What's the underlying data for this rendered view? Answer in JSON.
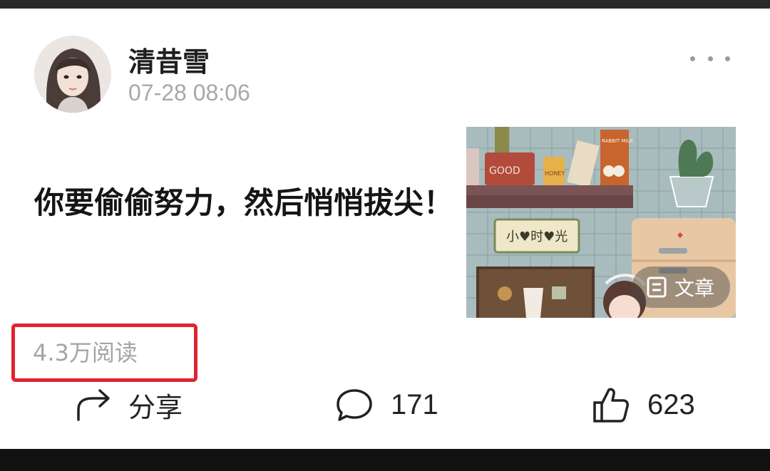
{
  "post": {
    "username": "清昔雪",
    "timestamp": "07-28 08:06",
    "headline": "你要偷偷努力，然后悄悄拔尖！",
    "reads": "4.3万阅读",
    "thumbnail": {
      "badge_label": "文章",
      "sign_text": "小♥时♥光",
      "jar_label": "HONEY",
      "box_label": "GOOD",
      "carton_label": "RABBIT MILK"
    }
  },
  "actions": {
    "share_label": "分享",
    "comment_count": "171",
    "like_count": "623"
  },
  "colors": {
    "highlight_box": "#e2232f",
    "secondary_text": "#a5a5a5",
    "primary_text": "#151515"
  },
  "icons": {
    "more": "more-dots-icon",
    "share": "share-arrow-icon",
    "comment": "comment-bubble-icon",
    "like": "thumbs-up-icon",
    "article": "article-doc-icon"
  }
}
